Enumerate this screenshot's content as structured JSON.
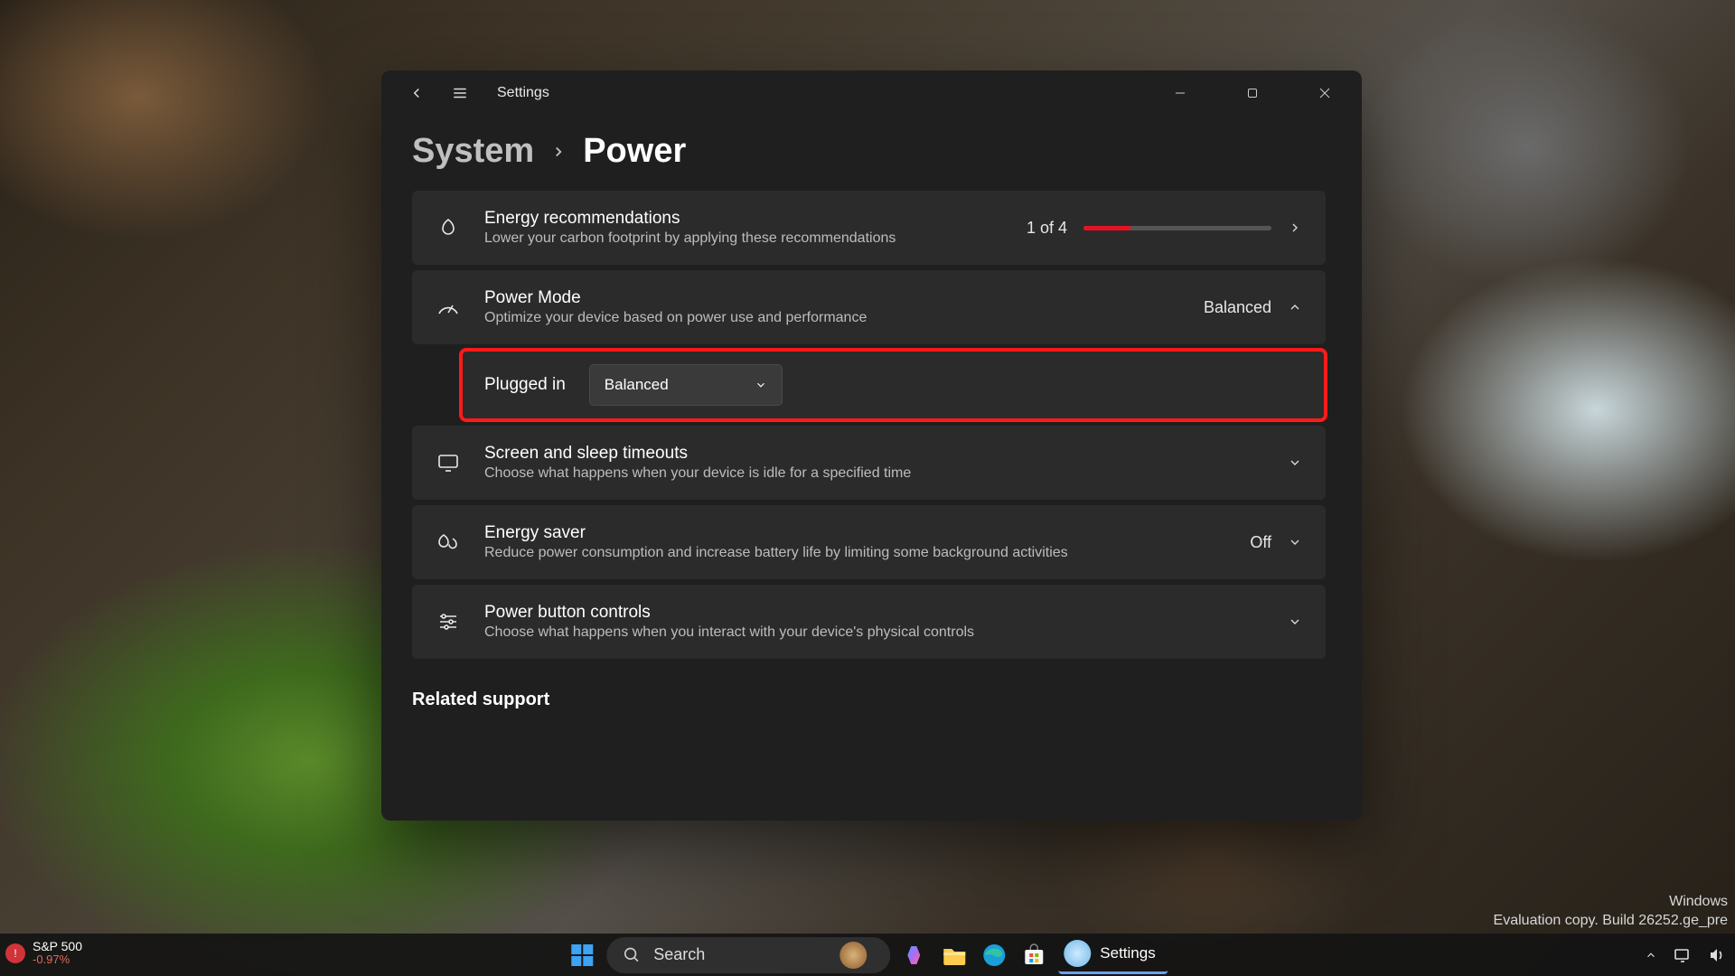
{
  "window": {
    "app_title": "Settings",
    "breadcrumb_parent": "System",
    "breadcrumb_current": "Power"
  },
  "cards": {
    "energy": {
      "title": "Energy recommendations",
      "sub": "Lower your carbon footprint by applying these recommendations",
      "counter": "1 of 4",
      "progress_pct": 25
    },
    "powermode": {
      "title": "Power Mode",
      "sub": "Optimize your device based on power use and performance",
      "value": "Balanced"
    },
    "pluggedin": {
      "label": "Plugged in",
      "value": "Balanced"
    },
    "screensleep": {
      "title": "Screen and sleep timeouts",
      "sub": "Choose what happens when your device is idle for a specified time"
    },
    "energysaver": {
      "title": "Energy saver",
      "sub": "Reduce power consumption and increase battery life by limiting some background activities",
      "value": "Off"
    },
    "powerbutton": {
      "title": "Power button controls",
      "sub": "Choose what happens when you interact with your device's physical controls"
    }
  },
  "related_heading": "Related support",
  "watermark": {
    "line1": "Windows",
    "line2": "Evaluation copy. Build 26252.ge_pre"
  },
  "taskbar": {
    "widget_title": "S&P 500",
    "widget_change": "-0.97%",
    "search_placeholder": "Search",
    "settings_label": "Settings"
  }
}
